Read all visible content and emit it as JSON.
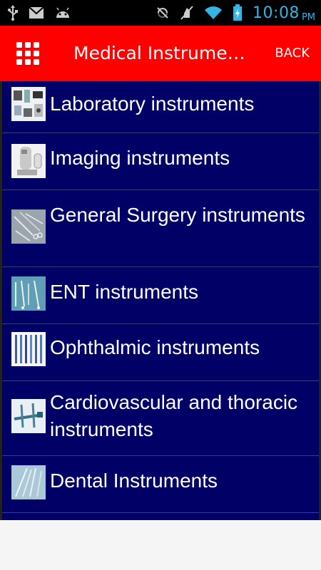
{
  "status_bar": {
    "icons_left": [
      "usb-icon",
      "gmail-icon",
      "android-icon"
    ],
    "icons_right": [
      "no-sim-icon",
      "mute-icon",
      "wifi-icon",
      "battery-icon"
    ],
    "time": "10:08",
    "ampm": "PM",
    "time_color": "#33b5e5"
  },
  "app_bar": {
    "title": "Medical Instrume…",
    "back_label": "BACK",
    "background": "#fe0000",
    "menu_icon": "grid-menu-icon"
  },
  "list": {
    "background": "#000066",
    "items": [
      {
        "label": "Laboratory instruments",
        "icon": "laboratory-instruments-thumbnail"
      },
      {
        "label": "Imaging instruments",
        "icon": "imaging-instruments-thumbnail"
      },
      {
        "label": "General Surgery instruments",
        "icon": "general-surgery-thumbnail"
      },
      {
        "label": "ENT instruments",
        "icon": "ent-instruments-thumbnail"
      },
      {
        "label": "Ophthalmic instruments",
        "icon": "ophthalmic-instruments-thumbnail"
      },
      {
        "label": "Cardiovascular and thoracic instruments",
        "icon": "cardiovascular-thumbnail"
      },
      {
        "label": "Dental Instruments",
        "icon": "dental-instruments-thumbnail"
      }
    ]
  }
}
